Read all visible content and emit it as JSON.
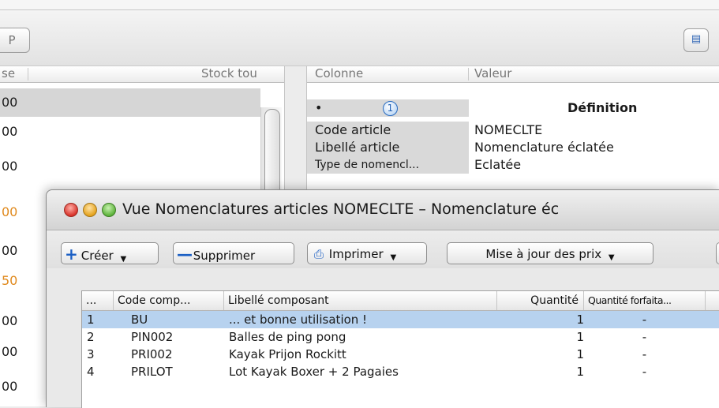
{
  "background_window": {
    "toolbar": {
      "p_button_label": "P",
      "view_button_icon": "view-icon"
    },
    "left_list": {
      "header_col1": "se",
      "header_col2": "Stock tou",
      "rows": [
        {
          "value": "00",
          "color": "#1a1a1a"
        },
        {
          "value": "00",
          "color": "#1a1a1a"
        },
        {
          "value": "00",
          "color": "#1a1a1a"
        },
        {
          "value": "00",
          "color": "#e08a1e"
        },
        {
          "value": "00",
          "color": "#1a1a1a"
        },
        {
          "value": "50",
          "color": "#e08a1e"
        },
        {
          "value": "00",
          "color": "#1a1a1a"
        },
        {
          "value": "00",
          "color": "#1a1a1a"
        },
        {
          "value": "00",
          "color": "#1a1a1a"
        }
      ]
    },
    "properties": {
      "header_col1": "Colonne",
      "header_col2": "Valeur",
      "bullet": "•",
      "badge_number": "1",
      "section_title": "Définition",
      "rows": [
        {
          "key": "Code article",
          "value": "NOMECLTE"
        },
        {
          "key": "Libellé article",
          "value": "Nomenclature éclatée"
        },
        {
          "key": "Type de nomencl...",
          "value": "Eclatée"
        }
      ]
    }
  },
  "front_window": {
    "title": "Vue Nomenclatures articles NOMECLTE – Nomenclature éc",
    "toolbar": {
      "creer_label": "Créer",
      "supprimer_label": "Supprimer",
      "imprimer_label": "Imprimer",
      "maj_prix_label": "Mise à jour des prix"
    },
    "table": {
      "columns": [
        "...",
        "Code comp...",
        "Libellé composant",
        "Quantité",
        "Quantité forfaita..."
      ],
      "rows": [
        {
          "num": "1",
          "code": "BU",
          "libelle": "... et bonne utilisation !",
          "quantite": "1",
          "quantite_forfait": "-"
        },
        {
          "num": "2",
          "code": "PIN002",
          "libelle": "Balles de ping pong",
          "quantite": "1",
          "quantite_forfait": "-"
        },
        {
          "num": "3",
          "code": "PRI002",
          "libelle": "Kayak Prijon Rockitt",
          "quantite": "1",
          "quantite_forfait": "-"
        },
        {
          "num": "4",
          "code": "PRILOT",
          "libelle": "Lot Kayak Boxer + 2 Pagaies",
          "quantite": "1",
          "quantite_forfait": "-"
        }
      ],
      "selected_row_index": 0
    }
  }
}
